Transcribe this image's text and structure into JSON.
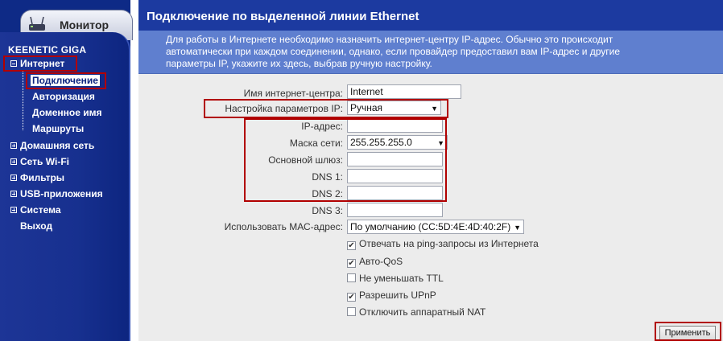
{
  "sidebar": {
    "monitor_label": "Монитор",
    "brand": "KEENETIC GIGA",
    "items": [
      {
        "label": "Интернет",
        "expanded": true
      },
      {
        "label": "Домашняя сеть",
        "expanded": false
      },
      {
        "label": "Сеть Wi-Fi",
        "expanded": false
      },
      {
        "label": "Фильтры",
        "expanded": false
      },
      {
        "label": "USB-приложения",
        "expanded": false
      },
      {
        "label": "Система",
        "expanded": false
      }
    ],
    "sub_items": [
      {
        "label": "Подключение",
        "active": true
      },
      {
        "label": "Авторизация",
        "active": false
      },
      {
        "label": "Доменное имя",
        "active": false
      },
      {
        "label": "Маршруты",
        "active": false
      }
    ],
    "exit_label": "Выход"
  },
  "header": {
    "title": "Подключение по выделенной линии Ethernet"
  },
  "info": {
    "line1": "Для работы в Интернете необходимо назначить интернет-центру IP-адрес. Обычно это происходит",
    "line2": "автоматически при каждом соединении, однако, если провайдер предоставил вам IP-адрес и другие",
    "line3": "параметры IP, укажите их здесь, выбрав ручную настройку."
  },
  "form": {
    "hostname": {
      "label": "Имя интернет-центра:",
      "value": "Internet"
    },
    "ip_mode": {
      "label": "Настройка параметров IP:",
      "value": "Ручная"
    },
    "ip_address": {
      "label": "IP-адрес:",
      "value": ""
    },
    "netmask": {
      "label": "Маска сети:",
      "value": "255.255.255.0"
    },
    "gateway": {
      "label": "Основной шлюз:",
      "value": ""
    },
    "dns1": {
      "label": "DNS 1:",
      "value": ""
    },
    "dns2": {
      "label": "DNS 2:",
      "value": ""
    },
    "dns3": {
      "label": "DNS 3:",
      "value": ""
    },
    "mac": {
      "label": "Использовать МАС-адрес:",
      "value": "По умолчанию (CC:5D:4E:4D:40:2F)"
    },
    "checkboxes": [
      {
        "label": "Отвечать на ping-запросы из Интернета",
        "checked": true
      },
      {
        "label": "Авто-QoS",
        "checked": true
      },
      {
        "label": "Не уменьшать TTL",
        "checked": false
      },
      {
        "label": "Разрешить UPnP",
        "checked": true
      },
      {
        "label": "Отключить аппаратный NAT",
        "checked": false
      }
    ]
  },
  "actions": {
    "apply_label": "Применить"
  },
  "colors": {
    "sidebar": "#17308f",
    "title_bar": "#1c3aa0",
    "info_box": "#5f7fcf",
    "highlight": "#b10000",
    "brand_text": "#ffffff"
  },
  "icons": {
    "monitor": "router-icon",
    "expand": "plus-square-icon",
    "select_arrow": "triangle-down-icon",
    "check": "checkmark-icon"
  }
}
